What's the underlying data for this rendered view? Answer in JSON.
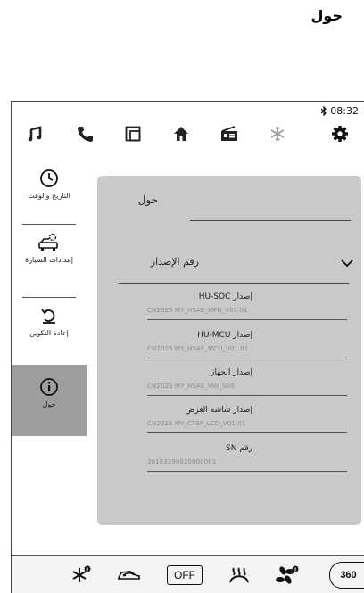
{
  "page": {
    "heading": "حول"
  },
  "status": {
    "bluetooth_icon": "bluetooth-icon",
    "time": "08:32"
  },
  "topnav": {
    "icons": [
      "music-icon",
      "phone-icon",
      "apps-icon",
      "home-icon",
      "radio-icon",
      "snowflake-icon",
      "gear-icon"
    ],
    "active": "gear-icon"
  },
  "sidebar": {
    "items": [
      {
        "label": "التاريخ والوقت",
        "icon": "clock-icon"
      },
      {
        "label": "إعدادات السيارة",
        "icon": "car-settings-icon"
      },
      {
        "label": "إعادة التكوين",
        "icon": "reset-icon"
      },
      {
        "label": "حول",
        "icon": "info-icon",
        "active": true
      }
    ]
  },
  "panel": {
    "title": "حول",
    "version_section": {
      "label": "رقم الإصدار",
      "expanded": true
    },
    "versions": [
      {
        "name": "إصدار HU-SOC",
        "value": "CN202S MY_HSAE_MPU_V01.01"
      },
      {
        "name": "إصدار HU-MCU",
        "value": "CN202S MY_HSAE_MCU_V01.01"
      },
      {
        "name": "إصدار الجهاز",
        "value": "CN202S MY_HSAE_HW_S00"
      },
      {
        "name": "إصدار شاشة العرض",
        "value": "CN202S MY_CTSP_LCD_V01.01"
      },
      {
        "name": "رقم SN",
        "value": "30163190820000001"
      }
    ]
  },
  "bottombar": {
    "icons": [
      "defrost-fan-icon",
      "car-recirculation-icon",
      "off-button",
      "windshield-defrost-icon",
      "fan-speed-icon",
      "camera-360-button"
    ],
    "off_label": "OFF",
    "label_360": "360"
  },
  "colors": {
    "panel_bg": "#c9c9c9",
    "active_sidebar_bg": "#9e9e9e",
    "text_muted": "#8a8a8a"
  }
}
